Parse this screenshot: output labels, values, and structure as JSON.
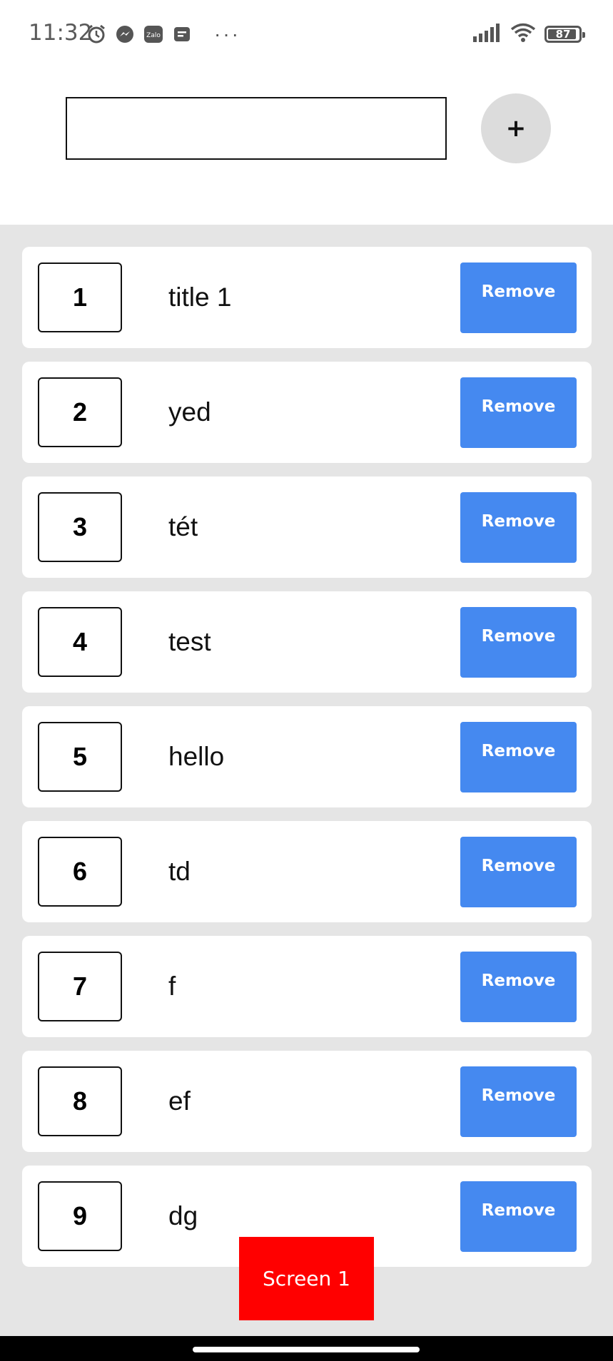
{
  "status_bar": {
    "time": "11:32",
    "left_icons": [
      "alarm-icon",
      "messenger-icon",
      "zalo-icon",
      "message-icon"
    ],
    "zalo_text": "Zalo",
    "more": "···",
    "battery": "87",
    "right_icons": [
      "signal-icon",
      "wifi-icon",
      "battery-icon"
    ]
  },
  "input": {
    "value": "",
    "placeholder": ""
  },
  "add_button": {
    "label": "+"
  },
  "items": [
    {
      "number": "1",
      "title": "title 1",
      "remove_label": "Remove"
    },
    {
      "number": "2",
      "title": "yed",
      "remove_label": "Remove"
    },
    {
      "number": "3",
      "title": "tét",
      "remove_label": "Remove"
    },
    {
      "number": "4",
      "title": "test",
      "remove_label": "Remove"
    },
    {
      "number": "5",
      "title": "hello",
      "remove_label": "Remove"
    },
    {
      "number": "6",
      "title": "td",
      "remove_label": "Remove"
    },
    {
      "number": "7",
      "title": "f",
      "remove_label": "Remove"
    },
    {
      "number": "8",
      "title": "ef",
      "remove_label": "Remove"
    },
    {
      "number": "9",
      "title": "dg",
      "remove_label": "Remove"
    }
  ],
  "screen_tab": {
    "label": "Screen 1"
  },
  "colors": {
    "remove_button": "#4589f0",
    "screen_tab": "#ff0000",
    "list_background": "#e5e5e5",
    "add_button": "#dcdcdc"
  }
}
